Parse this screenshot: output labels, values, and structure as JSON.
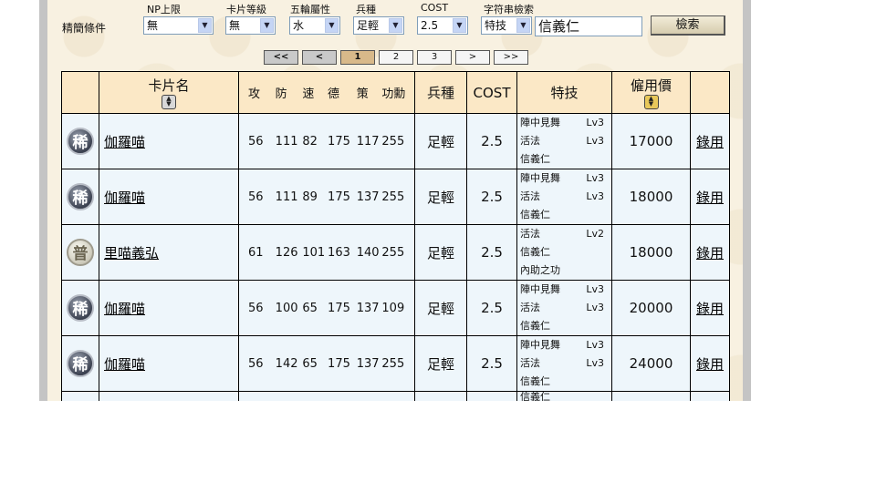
{
  "filters": {
    "main_label": "精簡條件",
    "np": {
      "label": "NP上限",
      "value": "無"
    },
    "card_level": {
      "label": "卡片等級",
      "value": "無"
    },
    "element": {
      "label": "五輪屬性",
      "value": "水"
    },
    "unit_type": {
      "label": "兵種",
      "value": "足輕"
    },
    "cost": {
      "label": "COST",
      "value": "2.5"
    },
    "text_search": {
      "label": "字符串檢索",
      "type_value": "特技",
      "query": "信義仁"
    },
    "search_button": "檢索"
  },
  "pager": {
    "first": "<<",
    "prev": "<",
    "pages": [
      "1",
      "2",
      "3"
    ],
    "current": "1",
    "next": ">",
    "last": ">>"
  },
  "table": {
    "headers": {
      "name": "卡片名",
      "stats": [
        "攻",
        "防",
        "速",
        "德",
        "策",
        "功勳"
      ],
      "unit": "兵種",
      "cost": "COST",
      "skills": "特技",
      "price": "僱用價"
    },
    "rows": [
      {
        "badge": "稀",
        "rarity": "rare",
        "name": "伽羅喵",
        "stats": [
          "56",
          "111",
          "82",
          "175",
          "117",
          "255"
        ],
        "unit": "足輕",
        "cost": "2.5",
        "skills": [
          {
            "name": "陣中見舞",
            "lv": "Lv3"
          },
          {
            "name": "活法",
            "lv": "Lv3"
          },
          {
            "name": "信義仁",
            "lv": ""
          }
        ],
        "price": "17000",
        "action": "錄用"
      },
      {
        "badge": "稀",
        "rarity": "rare",
        "name": "伽羅喵",
        "stats": [
          "56",
          "111",
          "89",
          "175",
          "137",
          "255"
        ],
        "unit": "足輕",
        "cost": "2.5",
        "skills": [
          {
            "name": "陣中見舞",
            "lv": "Lv3"
          },
          {
            "name": "活法",
            "lv": "Lv3"
          },
          {
            "name": "信義仁",
            "lv": ""
          }
        ],
        "price": "18000",
        "action": "錄用"
      },
      {
        "badge": "普",
        "rarity": "common",
        "name": "里喵義弘",
        "stats": [
          "61",
          "126",
          "101",
          "163",
          "140",
          "255"
        ],
        "unit": "足輕",
        "cost": "2.5",
        "skills": [
          {
            "name": "活法",
            "lv": "Lv2"
          },
          {
            "name": "信義仁",
            "lv": ""
          },
          {
            "name": "內助之功",
            "lv": ""
          }
        ],
        "price": "18000",
        "action": "錄用"
      },
      {
        "badge": "稀",
        "rarity": "rare",
        "name": "伽羅喵",
        "stats": [
          "56",
          "100",
          "65",
          "175",
          "137",
          "109"
        ],
        "unit": "足輕",
        "cost": "2.5",
        "skills": [
          {
            "name": "陣中見舞",
            "lv": "Lv3"
          },
          {
            "name": "活法",
            "lv": "Lv3"
          },
          {
            "name": "信義仁",
            "lv": ""
          }
        ],
        "price": "20000",
        "action": "錄用"
      },
      {
        "badge": "稀",
        "rarity": "rare",
        "name": "伽羅喵",
        "stats": [
          "56",
          "142",
          "65",
          "175",
          "137",
          "255"
        ],
        "unit": "足輕",
        "cost": "2.5",
        "skills": [
          {
            "name": "陣中見舞",
            "lv": "Lv3"
          },
          {
            "name": "活法",
            "lv": "Lv3"
          },
          {
            "name": "信義仁",
            "lv": ""
          }
        ],
        "price": "24000",
        "action": "錄用"
      }
    ],
    "partial_row_skill": "信義仁"
  }
}
